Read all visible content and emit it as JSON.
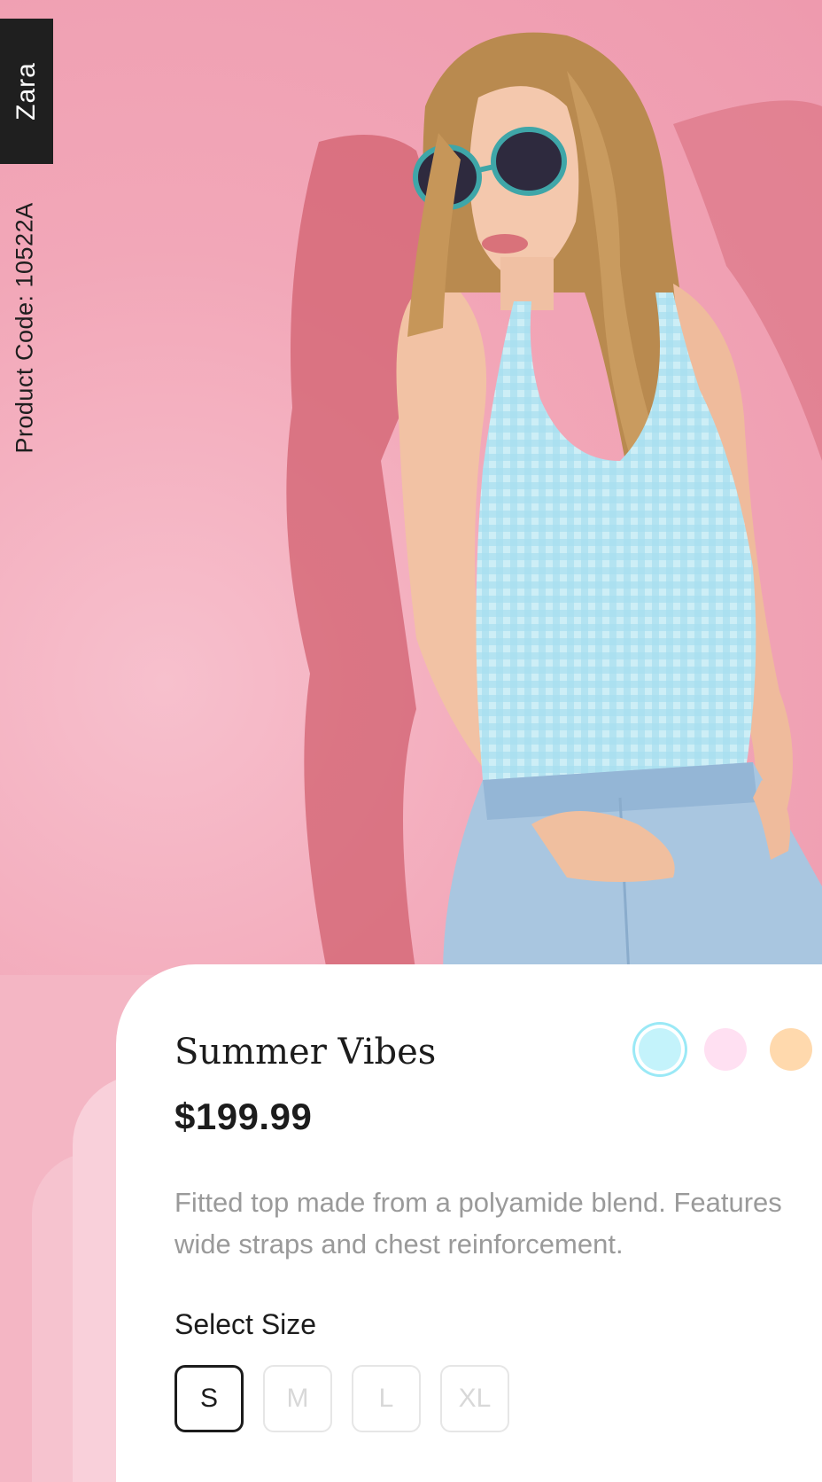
{
  "brand": {
    "name": "Zara"
  },
  "product": {
    "code_label": "Product Code: 10522A",
    "title": "Summer Vibes",
    "price": "$199.99",
    "description": "Fitted top made from a polyamide blend. Features wide straps and chest reinforcement.",
    "size_label": "Select Size",
    "sizes": [
      {
        "label": "S",
        "selected": true
      },
      {
        "label": "M",
        "selected": false
      },
      {
        "label": "L",
        "selected": false
      },
      {
        "label": "XL",
        "selected": false
      }
    ],
    "colors": [
      {
        "name": "light-blue",
        "hex": "#c4f3fb",
        "selected": true
      },
      {
        "name": "light-pink",
        "hex": "#ffe0f2",
        "selected": false
      },
      {
        "name": "peach",
        "hex": "#ffd9ad",
        "selected": false
      }
    ]
  },
  "theme": {
    "background": "#f4b6c4",
    "card": "#ffffff",
    "text": "#1c1c1c",
    "muted": "#9a9a9a"
  }
}
